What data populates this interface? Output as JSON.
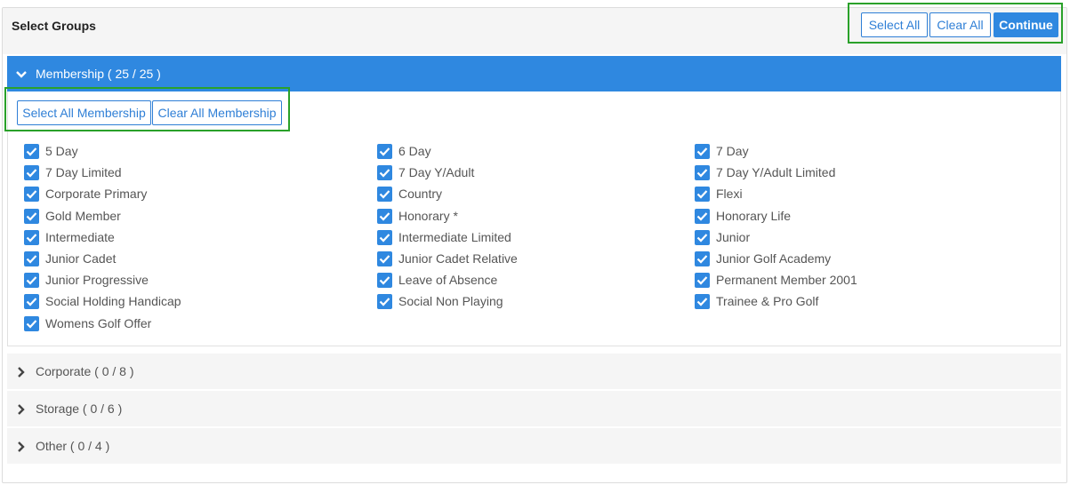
{
  "header": {
    "title": "Select Groups",
    "select_all_label": "Select All",
    "clear_all_label": "Clear All",
    "continue_label": "Continue"
  },
  "groups": [
    {
      "name": "Membership ( 25 / 25 )",
      "expanded": true,
      "select_all_label": "Select All Membership",
      "clear_all_label": "Clear All Membership",
      "columns": [
        [
          "5 Day",
          "7 Day Limited",
          "Corporate Primary",
          "Gold Member",
          "Intermediate",
          "Junior Cadet",
          "Junior Progressive",
          "Social Holding Handicap",
          "Womens Golf Offer"
        ],
        [
          "6 Day",
          "7 Day Y/Adult",
          "Country",
          "Honorary *",
          "Intermediate Limited",
          "Junior Cadet Relative",
          "Leave of Absence",
          "Social Non Playing"
        ],
        [
          "7 Day",
          "7 Day Y/Adult Limited",
          "Flexi",
          "Honorary Life",
          "Junior",
          "Junior Golf Academy",
          "Permanent Member 2001",
          "Trainee & Pro Golf"
        ]
      ],
      "checked": true
    },
    {
      "name": "Corporate ( 0 / 8 )",
      "expanded": false
    },
    {
      "name": "Storage ( 0 / 6 )",
      "expanded": false
    },
    {
      "name": "Other ( 0 / 4 )",
      "expanded": false
    }
  ],
  "colors": {
    "accent": "#2f88e0",
    "highlight_border": "#2aa12a",
    "header_bg": "#f5f5f5"
  },
  "icons": {
    "expanded": "chevron-down-icon",
    "collapsed": "chevron-right-icon",
    "checkbox": "checkbox-checked-icon"
  }
}
